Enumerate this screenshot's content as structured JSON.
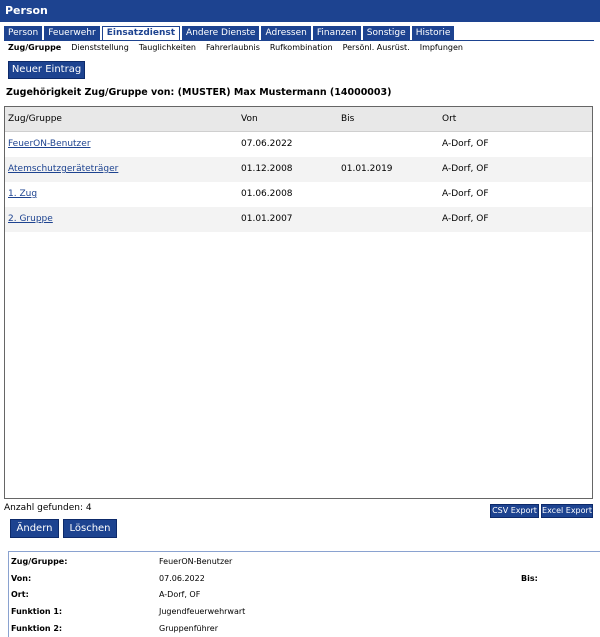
{
  "window": {
    "title": "Person"
  },
  "main_tabs": [
    {
      "label": "Person",
      "active": false
    },
    {
      "label": "Feuerwehr",
      "active": false
    },
    {
      "label": "Einsatzdienst",
      "active": true
    },
    {
      "label": "Andere Dienste",
      "active": false
    },
    {
      "label": "Adressen",
      "active": false
    },
    {
      "label": "Finanzen",
      "active": false
    },
    {
      "label": "Sonstige",
      "active": false
    },
    {
      "label": "Historie",
      "active": false
    }
  ],
  "sub_tabs": [
    {
      "label": "Zug/Gruppe",
      "active": true
    },
    {
      "label": "Dienststellung",
      "active": false
    },
    {
      "label": "Tauglichkeiten",
      "active": false
    },
    {
      "label": "Fahrerlaubnis",
      "active": false
    },
    {
      "label": "Rufkombination",
      "active": false
    },
    {
      "label": "Persönl. Ausrüst.",
      "active": false
    },
    {
      "label": "Impfungen",
      "active": false
    }
  ],
  "toolbar": {
    "new_label": "Neuer Eintrag"
  },
  "section_title": "Zugehörigkeit Zug/Gruppe von: (MUSTER) Max Mustermann (14000003)",
  "table": {
    "columns": [
      "Zug/Gruppe",
      "Von",
      "Bis",
      "Ort"
    ],
    "rows": [
      {
        "name": "FeuerON-Benutzer",
        "von": "07.06.2022",
        "bis": "",
        "ort": "A-Dorf, OF"
      },
      {
        "name": "Atemschutzgeräteträger",
        "von": "01.12.2008",
        "bis": "01.01.2019",
        "ort": "A-Dorf, OF"
      },
      {
        "name": "1. Zug",
        "von": "01.06.2008",
        "bis": "",
        "ort": "A-Dorf, OF"
      },
      {
        "name": "2. Gruppe",
        "von": "01.01.2007",
        "bis": "",
        "ort": "A-Dorf, OF"
      }
    ]
  },
  "footer": {
    "count_label": "Anzahl gefunden: 4",
    "csv_label": "CSV Export",
    "excel_label": "Excel Export",
    "edit_label": "Ändern",
    "delete_label": "Löschen"
  },
  "detail": {
    "group_label": "Zug/Gruppe:",
    "group_value": "FeuerON-Benutzer",
    "von_label": "Von:",
    "von_value": "07.06.2022",
    "bis_label": "Bis:",
    "ort_label": "Ort:",
    "ort_value": "A-Dorf, OF",
    "funktion1_label": "Funktion 1:",
    "funktion1_value": "Jugendfeuerwehrwart",
    "funktion2_label": "Funktion 2:",
    "funktion2_value": "Gruppenführer"
  }
}
